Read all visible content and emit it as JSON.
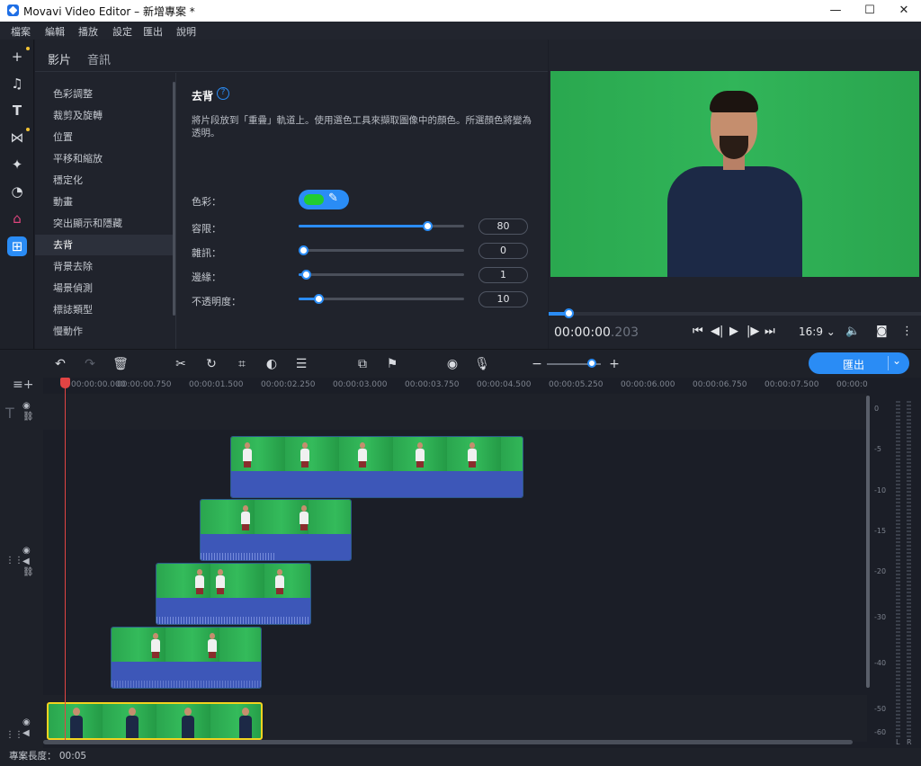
{
  "window": {
    "title": "Movavi Video Editor – 新增專案 *",
    "minimize": "—",
    "maximize": "☐",
    "close": "✕"
  },
  "menu": [
    "檔案",
    "編輯",
    "播放",
    "設定",
    "匯出",
    "說明"
  ],
  "panel": {
    "tabs": [
      "影片",
      "音訊"
    ],
    "categories": [
      "色彩調整",
      "裁剪及旋轉",
      "位置",
      "平移和縮放",
      "穩定化",
      "動畫",
      "突出顯示和隱藏",
      "去背",
      "背景去除",
      "場景偵測",
      "標誌類型",
      "慢動作"
    ],
    "selected_category": "去背"
  },
  "chroma": {
    "heading": "去背",
    "help": "?",
    "description": "將片段放到「重疊」軌道上。使用選色工具來擷取圖像中的顏色。所選顏色將變為透明。",
    "color_label": "色彩：",
    "picked_color": "#21cc31",
    "sliders": [
      {
        "label": "容限：",
        "value": "80",
        "level": 0.8
      },
      {
        "label": "雜訊：",
        "value": "0",
        "level": 0.0
      },
      {
        "label": "邊緣：",
        "value": "1",
        "level": 0.02
      },
      {
        "label": "不透明度：",
        "value": "10",
        "level": 0.1
      }
    ]
  },
  "player": {
    "timecode_main": "00:00:00",
    "timecode_ms": ".203",
    "aspect": "16:9",
    "progress": 0.04
  },
  "timeline": {
    "ruler": [
      "00:00:00.000",
      "00:00:00.750",
      "00:00:01.500",
      "00:00:02.250",
      "00:00:03.000",
      "00:00:03.750",
      "00:00:04.500",
      "00:00:05.250",
      "00:00:06.000",
      "00:00:06.750",
      "00:00:07.500",
      "00:00:0"
    ],
    "export_label": "匯出"
  },
  "meter": {
    "labels": [
      "0",
      "-5",
      "-10",
      "-15",
      "-20",
      "-30",
      "-40",
      "-50",
      "-60"
    ],
    "channels": [
      "L",
      "R"
    ]
  },
  "status": {
    "project_length": "專案長度：  00:05"
  },
  "accent_color": "#2a8cf5"
}
